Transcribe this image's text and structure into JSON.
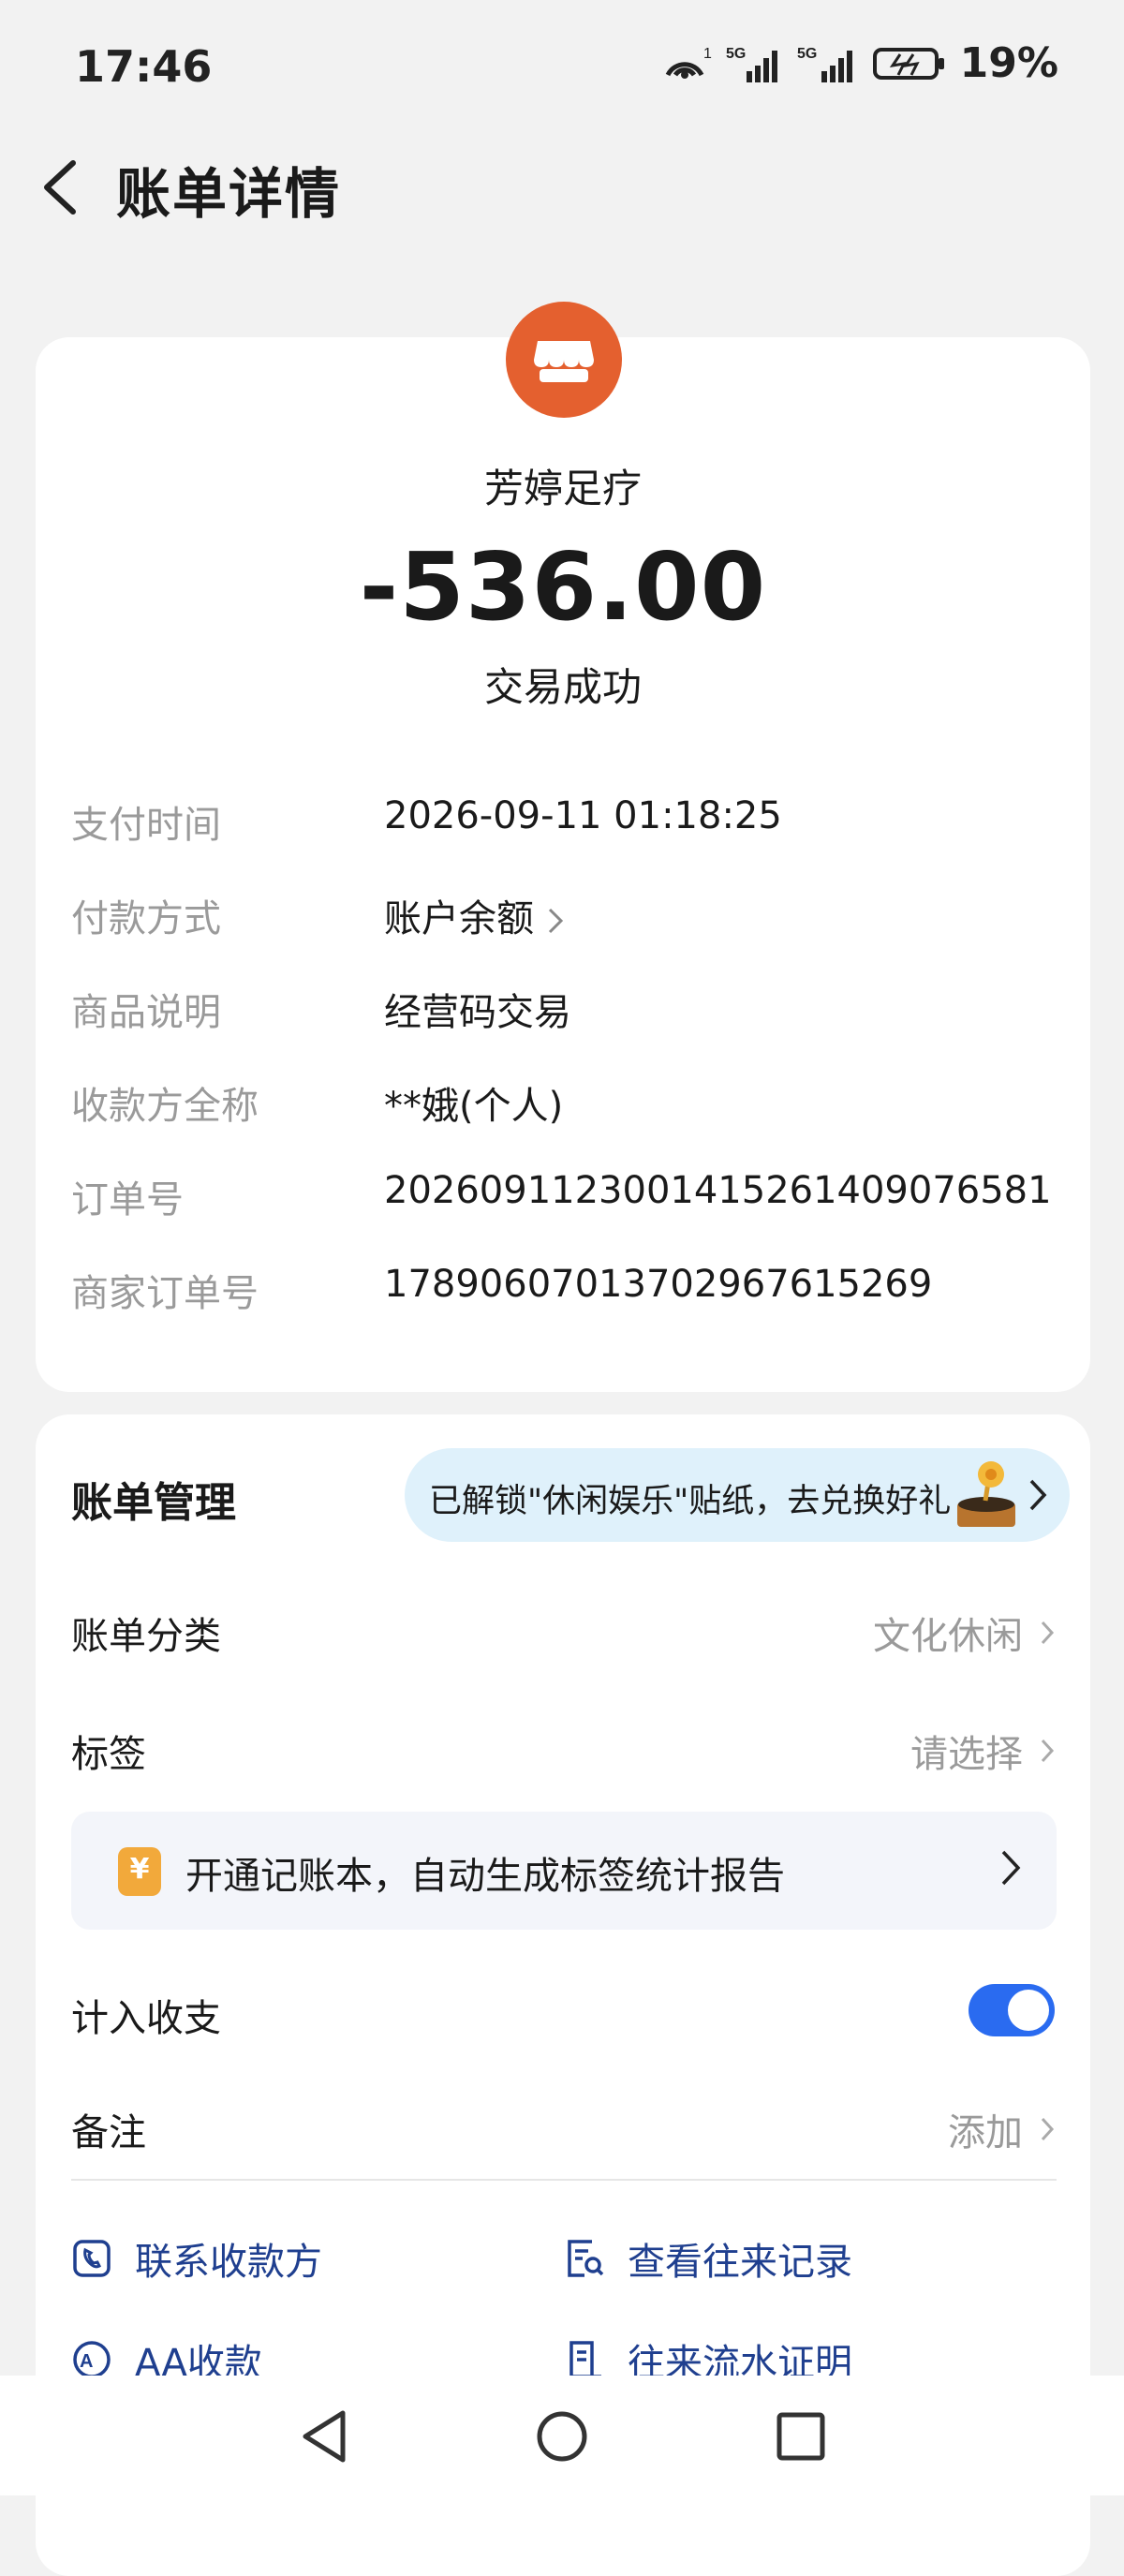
{
  "status_bar": {
    "time": "17:46",
    "battery": "19%"
  },
  "header": {
    "title": "账单详情"
  },
  "merchant": {
    "name": "芳婷足疗",
    "amount": "-536.00",
    "status": "交易成功",
    "icon_color": "#e4602f"
  },
  "details": [
    {
      "label": "支付时间",
      "value": "2026-09-11 01:18:25"
    },
    {
      "label": "付款方式",
      "value": "账户余额"
    },
    {
      "label": "商品说明",
      "value": "经营码交易"
    },
    {
      "label": "收款方全称",
      "value": "**娥(个人)"
    },
    {
      "label": "订单号",
      "value": "20260911230014152614090765​81"
    },
    {
      "label": "商家订单号",
      "value": "1789060701370296761526​9"
    }
  ],
  "management": {
    "title": "账单管理",
    "promo_pill": "已解锁\"休闲娱乐\"贴纸，去兑换好礼",
    "category": {
      "label": "账单分类",
      "value": "文化休闲"
    },
    "tag": {
      "label": "标签",
      "value": "请选择"
    },
    "promo": {
      "icon": "¥",
      "text": "开通记账本，自动生成标签统计报告"
    },
    "include": {
      "label": "计入收支",
      "on": true
    },
    "note": {
      "label": "备注",
      "value": "添加"
    },
    "accent_color": "#2a6bf0"
  },
  "actions": {
    "contact": "联系收款方",
    "history": "查看往来记录",
    "aa": "AA收款",
    "proof": "往来流水证明"
  }
}
